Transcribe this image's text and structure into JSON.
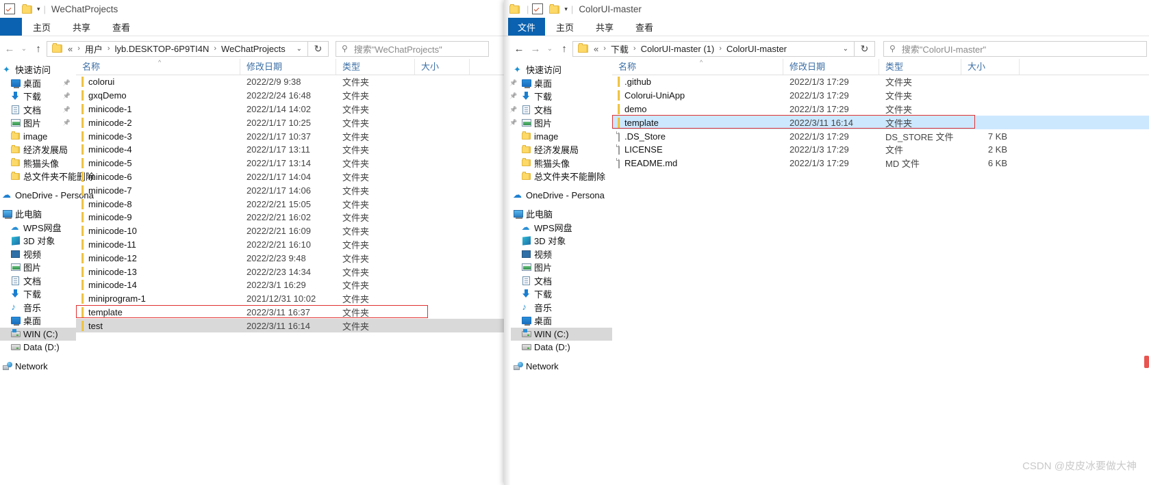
{
  "left_window": {
    "title": "WeChatProjects",
    "quick_access_icon": "quick-access-checkbox-icon",
    "ribbon_tabs": [
      "主页",
      "共享",
      "查看"
    ],
    "nav": {
      "back": "←",
      "forward": "→",
      "recent": "⌄",
      "up": "↑"
    },
    "breadcrumb": [
      "«",
      "用户",
      "lyb.DESKTOP-6P9TI4N",
      "WeChatProjects"
    ],
    "refresh_label": "↻",
    "search_placeholder": "搜索\"WeChatProjects\"",
    "sidebar": [
      {
        "label": "快速访问",
        "icon": "star-icon",
        "indent": 0,
        "pinned": false,
        "selected": false
      },
      {
        "label": "桌面",
        "icon": "desktop-icon",
        "indent": 1,
        "pinned": true,
        "selected": false
      },
      {
        "label": "下载",
        "icon": "download-icon",
        "indent": 1,
        "pinned": true,
        "selected": false
      },
      {
        "label": "文档",
        "icon": "documents-icon",
        "indent": 1,
        "pinned": true,
        "selected": false
      },
      {
        "label": "图片",
        "icon": "pictures-icon",
        "indent": 1,
        "pinned": true,
        "selected": false
      },
      {
        "label": "image",
        "icon": "folder-icon",
        "indent": 1,
        "pinned": false,
        "selected": false
      },
      {
        "label": "经济发展局",
        "icon": "folder-icon",
        "indent": 1,
        "pinned": false,
        "selected": false
      },
      {
        "label": "熊猫头像",
        "icon": "folder-icon",
        "indent": 1,
        "pinned": false,
        "selected": false
      },
      {
        "label": "总文件夹不能删除",
        "icon": "folder-icon",
        "indent": 1,
        "pinned": false,
        "selected": false
      },
      {
        "label": "OneDrive - Persona",
        "icon": "onedrive-cloud-icon",
        "indent": 0,
        "pinned": false,
        "selected": false
      },
      {
        "label": "此电脑",
        "icon": "this-pc-icon",
        "indent": 0,
        "pinned": false,
        "selected": false
      },
      {
        "label": "WPS网盘",
        "icon": "wps-cloud-icon",
        "indent": 1,
        "pinned": false,
        "selected": false
      },
      {
        "label": "3D 对象",
        "icon": "3d-objects-icon",
        "indent": 1,
        "pinned": false,
        "selected": false
      },
      {
        "label": "视频",
        "icon": "videos-icon",
        "indent": 1,
        "pinned": false,
        "selected": false
      },
      {
        "label": "图片",
        "icon": "pictures-icon",
        "indent": 1,
        "pinned": false,
        "selected": false
      },
      {
        "label": "文档",
        "icon": "documents-icon",
        "indent": 1,
        "pinned": false,
        "selected": false
      },
      {
        "label": "下载",
        "icon": "download-icon",
        "indent": 1,
        "pinned": false,
        "selected": false
      },
      {
        "label": "音乐",
        "icon": "music-icon",
        "indent": 1,
        "pinned": false,
        "selected": false
      },
      {
        "label": "桌面",
        "icon": "desktop-icon",
        "indent": 1,
        "pinned": false,
        "selected": false
      },
      {
        "label": "WIN (C:)",
        "icon": "windows-drive-icon",
        "indent": 1,
        "pinned": false,
        "selected": true
      },
      {
        "label": "Data (D:)",
        "icon": "drive-icon",
        "indent": 1,
        "pinned": false,
        "selected": false
      },
      {
        "label": "Network",
        "icon": "network-icon",
        "indent": 0,
        "pinned": false,
        "selected": false
      }
    ],
    "columns": [
      "名称",
      "修改日期",
      "类型",
      "大小"
    ],
    "rows": [
      {
        "name": "colorui",
        "icon": "folder-icon",
        "date": "2022/2/9 9:38",
        "type": "文件夹",
        "size": ""
      },
      {
        "name": "gxqDemo",
        "icon": "folder-icon",
        "date": "2022/2/24 16:48",
        "type": "文件夹",
        "size": ""
      },
      {
        "name": "minicode-1",
        "icon": "folder-icon",
        "date": "2022/1/14 14:02",
        "type": "文件夹",
        "size": ""
      },
      {
        "name": "minicode-2",
        "icon": "folder-icon",
        "date": "2022/1/17 10:25",
        "type": "文件夹",
        "size": ""
      },
      {
        "name": "minicode-3",
        "icon": "folder-icon",
        "date": "2022/1/17 10:37",
        "type": "文件夹",
        "size": ""
      },
      {
        "name": "minicode-4",
        "icon": "folder-icon",
        "date": "2022/1/17 13:11",
        "type": "文件夹",
        "size": ""
      },
      {
        "name": "minicode-5",
        "icon": "folder-icon",
        "date": "2022/1/17 13:14",
        "type": "文件夹",
        "size": ""
      },
      {
        "name": "minicode-6",
        "icon": "folder-icon",
        "date": "2022/1/17 14:04",
        "type": "文件夹",
        "size": ""
      },
      {
        "name": "minicode-7",
        "icon": "folder-icon",
        "date": "2022/1/17 14:06",
        "type": "文件夹",
        "size": ""
      },
      {
        "name": "minicode-8",
        "icon": "folder-icon",
        "date": "2022/2/21 15:05",
        "type": "文件夹",
        "size": ""
      },
      {
        "name": "minicode-9",
        "icon": "folder-icon",
        "date": "2022/2/21 16:02",
        "type": "文件夹",
        "size": ""
      },
      {
        "name": "minicode-10",
        "icon": "folder-icon",
        "date": "2022/2/21 16:09",
        "type": "文件夹",
        "size": ""
      },
      {
        "name": "minicode-11",
        "icon": "folder-icon",
        "date": "2022/2/21 16:10",
        "type": "文件夹",
        "size": ""
      },
      {
        "name": "minicode-12",
        "icon": "folder-icon",
        "date": "2022/2/23 9:48",
        "type": "文件夹",
        "size": ""
      },
      {
        "name": "minicode-13",
        "icon": "folder-icon",
        "date": "2022/2/23 14:34",
        "type": "文件夹",
        "size": ""
      },
      {
        "name": "minicode-14",
        "icon": "folder-icon",
        "date": "2022/3/1 16:29",
        "type": "文件夹",
        "size": ""
      },
      {
        "name": "miniprogram-1",
        "icon": "folder-icon",
        "date": "2021/12/31 10:02",
        "type": "文件夹",
        "size": ""
      },
      {
        "name": "template",
        "icon": "folder-icon",
        "date": "2022/3/11 16:37",
        "type": "文件夹",
        "size": "",
        "highlight_box": true
      },
      {
        "name": "test",
        "icon": "folder-icon",
        "date": "2022/3/11 16:14",
        "type": "文件夹",
        "size": "",
        "selected": true
      }
    ]
  },
  "right_window": {
    "title": "ColorUI-master",
    "ribbon_file_tab": "文件",
    "ribbon_tabs": [
      "主页",
      "共享",
      "查看"
    ],
    "breadcrumb": [
      "«",
      "下载",
      "ColorUI-master (1)",
      "ColorUI-master"
    ],
    "refresh_label": "↻",
    "search_placeholder": "搜索\"ColorUI-master\"",
    "sidebar": [
      {
        "label": "快速访问",
        "icon": "star-icon",
        "indent": 0,
        "pinned": false,
        "selected": false
      },
      {
        "label": "桌面",
        "icon": "desktop-icon",
        "indent": 1,
        "pinned": true,
        "selected": false
      },
      {
        "label": "下载",
        "icon": "download-icon",
        "indent": 1,
        "pinned": true,
        "selected": false
      },
      {
        "label": "文档",
        "icon": "documents-icon",
        "indent": 1,
        "pinned": true,
        "selected": false
      },
      {
        "label": "图片",
        "icon": "pictures-icon",
        "indent": 1,
        "pinned": true,
        "selected": false
      },
      {
        "label": "image",
        "icon": "folder-icon",
        "indent": 1,
        "pinned": false,
        "selected": false
      },
      {
        "label": "经济发展局",
        "icon": "folder-icon",
        "indent": 1,
        "pinned": false,
        "selected": false
      },
      {
        "label": "熊猫头像",
        "icon": "folder-icon",
        "indent": 1,
        "pinned": false,
        "selected": false
      },
      {
        "label": "总文件夹不能删除",
        "icon": "folder-icon",
        "indent": 1,
        "pinned": false,
        "selected": false
      },
      {
        "label": "OneDrive - Persona",
        "icon": "onedrive-cloud-icon",
        "indent": 0,
        "pinned": false,
        "selected": false
      },
      {
        "label": "此电脑",
        "icon": "this-pc-icon",
        "indent": 0,
        "pinned": false,
        "selected": false
      },
      {
        "label": "WPS网盘",
        "icon": "wps-cloud-icon",
        "indent": 1,
        "pinned": false,
        "selected": false
      },
      {
        "label": "3D 对象",
        "icon": "3d-objects-icon",
        "indent": 1,
        "pinned": false,
        "selected": false
      },
      {
        "label": "视频",
        "icon": "videos-icon",
        "indent": 1,
        "pinned": false,
        "selected": false
      },
      {
        "label": "图片",
        "icon": "pictures-icon",
        "indent": 1,
        "pinned": false,
        "selected": false
      },
      {
        "label": "文档",
        "icon": "documents-icon",
        "indent": 1,
        "pinned": false,
        "selected": false
      },
      {
        "label": "下载",
        "icon": "download-icon",
        "indent": 1,
        "pinned": false,
        "selected": false
      },
      {
        "label": "音乐",
        "icon": "music-icon",
        "indent": 1,
        "pinned": false,
        "selected": false
      },
      {
        "label": "桌面",
        "icon": "desktop-icon",
        "indent": 1,
        "pinned": false,
        "selected": false
      },
      {
        "label": "WIN (C:)",
        "icon": "windows-drive-icon",
        "indent": 1,
        "pinned": false,
        "selected": true
      },
      {
        "label": "Data (D:)",
        "icon": "drive-icon",
        "indent": 1,
        "pinned": false,
        "selected": false
      },
      {
        "label": "Network",
        "icon": "network-icon",
        "indent": 0,
        "pinned": false,
        "selected": false
      }
    ],
    "columns": [
      "名称",
      "修改日期",
      "类型",
      "大小"
    ],
    "rows": [
      {
        "name": ".github",
        "icon": "folder-icon",
        "date": "2022/1/3 17:29",
        "type": "文件夹",
        "size": ""
      },
      {
        "name": "Colorui-UniApp",
        "icon": "folder-icon",
        "date": "2022/1/3 17:29",
        "type": "文件夹",
        "size": ""
      },
      {
        "name": "demo",
        "icon": "folder-icon",
        "date": "2022/1/3 17:29",
        "type": "文件夹",
        "size": ""
      },
      {
        "name": "template",
        "icon": "folder-icon",
        "date": "2022/3/11 16:14",
        "type": "文件夹",
        "size": "",
        "selected": true,
        "highlight_box": true
      },
      {
        "name": ".DS_Store",
        "icon": "file-icon",
        "date": "2022/1/3 17:29",
        "type": "DS_STORE 文件",
        "size": "7 KB"
      },
      {
        "name": "LICENSE",
        "icon": "file-icon",
        "date": "2022/1/3 17:29",
        "type": "文件",
        "size": "2 KB"
      },
      {
        "name": "README.md",
        "icon": "file-icon",
        "date": "2022/1/3 17:29",
        "type": "MD 文件",
        "size": "6 KB"
      }
    ]
  },
  "watermark": "CSDN @皮皮冰要做大神",
  "colors": {
    "accent_blue": "#0a62b0",
    "selection_blue": "#cce8ff",
    "selection_gray": "#d9d9d9",
    "highlight_red": "#e03030",
    "folder_yellow": "#fcd968",
    "column_header_text": "#3a6ea5"
  }
}
